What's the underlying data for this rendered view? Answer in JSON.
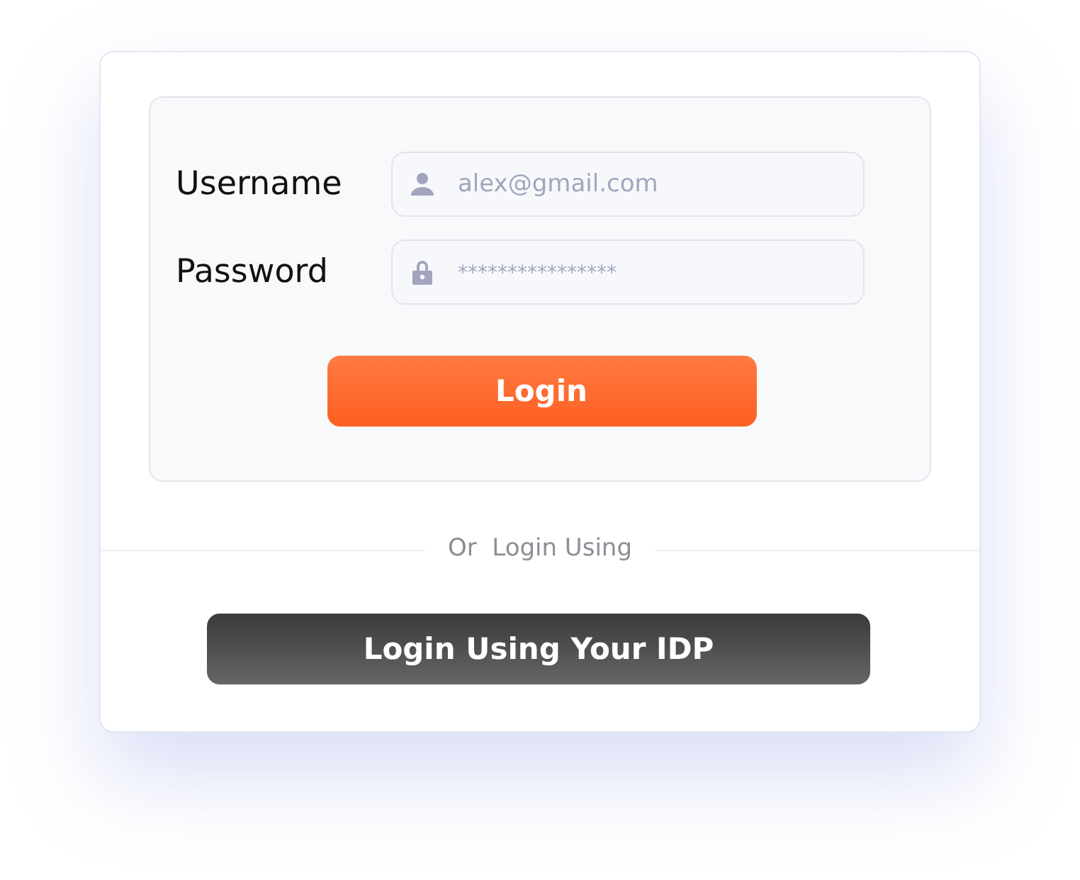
{
  "form": {
    "fields": [
      {
        "kind": "text",
        "label": "Username",
        "placeholder": "alex@gmail.com"
      },
      {
        "kind": "password",
        "label": "Password",
        "placeholder": "****************"
      }
    ],
    "submit": "Login"
  },
  "divider": "Or  Login Using",
  "idp_button": "Login Using Your IDP"
}
